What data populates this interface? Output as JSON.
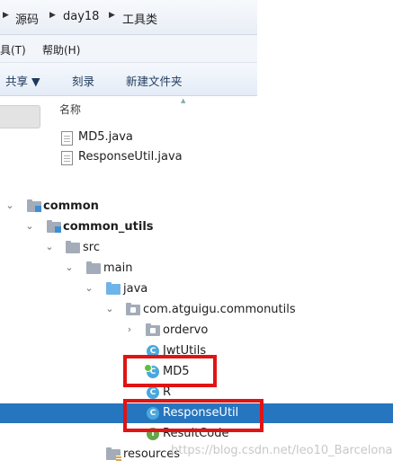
{
  "explorer": {
    "breadcrumb": [
      "源码",
      "day18",
      "工具类"
    ],
    "menu": [
      "具(T)",
      "帮助(H)"
    ],
    "toolbar": {
      "share": "共享 ▼",
      "burn": "刻录",
      "new_folder": "新建文件夹"
    },
    "column_name": "名称",
    "files": [
      {
        "name": "MD5.java"
      },
      {
        "name": "ResponseUtil.java"
      }
    ]
  },
  "tree": {
    "nodes": [
      {
        "label": "common",
        "toggle": "⌄",
        "icon": "module-folder-icon"
      },
      {
        "label": "common_utils",
        "toggle": "⌄",
        "icon": "module-folder-icon"
      },
      {
        "label": "src",
        "toggle": "⌄",
        "icon": "folder-icon"
      },
      {
        "label": "main",
        "toggle": "⌄",
        "icon": "folder-icon"
      },
      {
        "label": "java",
        "toggle": "⌄",
        "icon": "source-folder-icon"
      },
      {
        "label": "com.atguigu.commonutils",
        "toggle": "⌄",
        "icon": "package-icon"
      },
      {
        "label": "ordervo",
        "toggle": "›",
        "icon": "package-icon"
      },
      {
        "label": "JwtUtils",
        "icon": "class-icon",
        "icon_letter": "C"
      },
      {
        "label": "MD5",
        "icon": "class-icon",
        "icon_letter": "C"
      },
      {
        "label": "R",
        "icon": "class-icon",
        "icon_letter": "C"
      },
      {
        "label": "ResponseUtil",
        "icon": "class-icon",
        "icon_letter": "C"
      },
      {
        "label": "ResultCode",
        "icon": "interface-icon",
        "icon_letter": "I"
      },
      {
        "label": "resources",
        "icon": "resources-folder-icon"
      }
    ],
    "selected": "ResponseUtil",
    "highlighted": [
      "MD5",
      "ResponseUtil"
    ]
  },
  "watermark": "https://blog.csdn.net/leo10_Barcelona",
  "colors": {
    "selection": "#2675bf",
    "highlight_border": "#e01414",
    "class_icon": "#4aa8dc",
    "interface_icon": "#65a64a"
  }
}
